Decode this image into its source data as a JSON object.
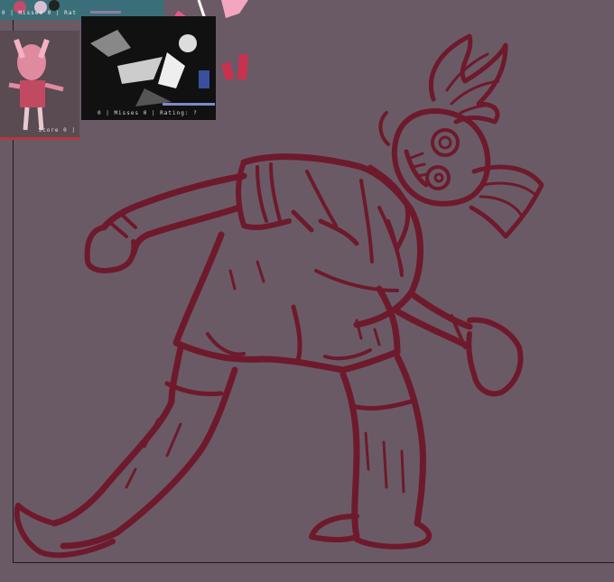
{
  "references": {
    "top_hud": "0 | Misses  0 | Rat",
    "game_hud": "0 | Misses  0 | Rating: ?",
    "doll_hud": "Score 0 |"
  },
  "colors": {
    "canvas": "#6a5a66",
    "ink": "#6e1a2c",
    "accent_red": "#b03a3a"
  }
}
